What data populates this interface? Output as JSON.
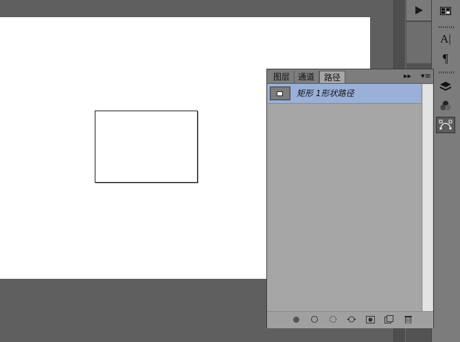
{
  "panel": {
    "tabs": [
      {
        "label": "图层"
      },
      {
        "label": "通道"
      },
      {
        "label": "路径"
      }
    ],
    "active_tab": "路径",
    "paths": [
      {
        "name": "矩形 1形状路径"
      }
    ]
  },
  "icons": {
    "play": "play-icon",
    "swatches": "swatches-icon",
    "character": "character-icon",
    "paragraph": "paragraph-icon",
    "layers": "layers-icon",
    "channels": "channels-icon",
    "paths": "paths-icon"
  },
  "colors": {
    "selected_row": "#9ab0d8",
    "panel_bg": "#a6a6a6",
    "workspace_bg": "#5f5f5f"
  }
}
